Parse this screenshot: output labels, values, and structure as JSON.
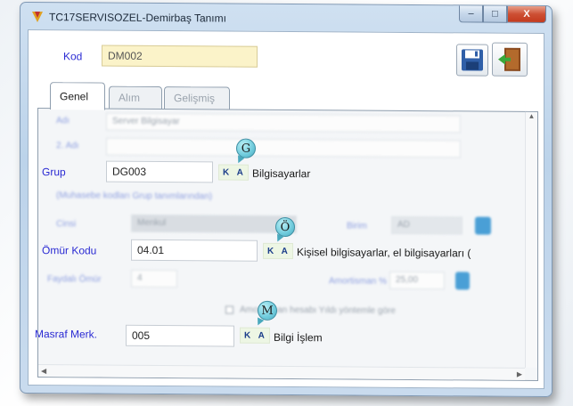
{
  "window": {
    "title": "TC17SERVISOZEL-Demirbaş Tanımı",
    "minimize_label": "–",
    "maximize_label": "□",
    "close_label": "X"
  },
  "header": {
    "kod_label": "Kod",
    "kod_value": "DM002"
  },
  "tabs": [
    {
      "label": "Genel",
      "active": true
    },
    {
      "label": "Alım",
      "active": false
    },
    {
      "label": "Gelişmiş",
      "active": false
    }
  ],
  "form": {
    "adi_label": "Adı",
    "adi_value": "Server Bilgisayar",
    "adi2_label": "2. Adı",
    "grup_label": "Grup",
    "grup_value": "DG003",
    "grup_ka": "K A",
    "grup_desc": "Bilgisayarlar",
    "grup_note": "(Muhasebe kodları Grup tanımlarından)",
    "cinsi_label": "Cinsi",
    "cinsi_value": "Menkul",
    "birim_label": "Birim",
    "birim_value": "AD",
    "omur_label": "Ömür Kodu",
    "omur_value": "04.01",
    "omur_ka": "K A",
    "omur_desc": "Kişisel bilgisayarlar, el bilgisayarları (",
    "faydali_label": "Faydalı Ömür",
    "faydali_value": "4",
    "amort_label": "Amortisman %",
    "amort_value": "25,00",
    "check_label": "Amortisman hesabı Yıldı yöntemle göre",
    "masraf_label": "Masraf Merk.",
    "masraf_value": "005",
    "masraf_ka": "K A",
    "masraf_desc": "Bilgi İşlem"
  },
  "annotations": {
    "g": "G",
    "o": "Ö",
    "m": "M"
  },
  "icons": {
    "save": "floppy-disk-icon",
    "exit": "exit-door-icon",
    "calc": "calculator-icon"
  },
  "colors": {
    "label_blue": "#2b2bd3",
    "kod_field_bg": "#fbf3c9",
    "window_frame": "#bcd3ea",
    "close_red": "#c33a1e"
  }
}
